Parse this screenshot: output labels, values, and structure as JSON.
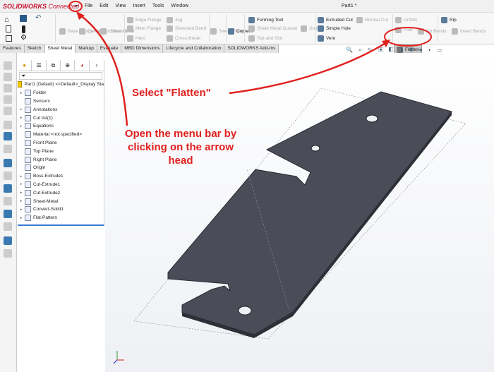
{
  "app": {
    "brand": "SOLIDWORKS",
    "brand_suffix": "Connected",
    "document_title": "Part1 *",
    "menu": [
      "File",
      "Edit",
      "View",
      "Insert",
      "Tools",
      "Window"
    ]
  },
  "ribbon": {
    "tools": [
      {
        "label": "Base Flange/Tab",
        "enabled": false
      },
      {
        "label": "Convert to Sheet Metal",
        "enabled": false
      },
      {
        "label": "Lofted-Bend",
        "enabled": false
      },
      {
        "label": "Edge Flange",
        "enabled": false
      },
      {
        "label": "Miter Flange",
        "enabled": false
      },
      {
        "label": "Hem",
        "enabled": false
      },
      {
        "label": "Jog",
        "enabled": false
      },
      {
        "label": "Sketched Bend",
        "enabled": false
      },
      {
        "label": "Cross-Break",
        "enabled": false
      },
      {
        "label": "Swept Flange",
        "enabled": false
      },
      {
        "label": "Corners",
        "enabled": true
      },
      {
        "label": "Forming Tool",
        "enabled": true
      },
      {
        "label": "Sheet Metal Gusset",
        "enabled": false
      },
      {
        "label": "Tab and Slot",
        "enabled": false
      },
      {
        "label": "Stamp",
        "enabled": false
      },
      {
        "label": "Extruded Cut",
        "enabled": true
      },
      {
        "label": "Simple Hole",
        "enabled": true
      },
      {
        "label": "Vent",
        "enabled": true
      },
      {
        "label": "Normal Cut",
        "enabled": false
      },
      {
        "label": "Unfold",
        "enabled": false
      },
      {
        "label": "Fold",
        "enabled": false
      },
      {
        "label": "No Bends",
        "enabled": false
      },
      {
        "label": "Rip",
        "enabled": true
      },
      {
        "label": "Insert Bends",
        "enabled": false
      }
    ],
    "flatten": "Flatten"
  },
  "tabs": [
    {
      "label": "Features"
    },
    {
      "label": "Sketch"
    },
    {
      "label": "Sheet Metal",
      "active": true
    },
    {
      "label": "Markup"
    },
    {
      "label": "Evaluate"
    },
    {
      "label": "MBD Dimensions"
    },
    {
      "label": "Lifecycle and Collaboration"
    },
    {
      "label": "SOLIDWORKS Add-Ins"
    }
  ],
  "tree": {
    "root": "Part1 (Default) <<Default>_Display Sta",
    "items": [
      {
        "label": "Folder",
        "expand": true
      },
      {
        "label": "Sensors",
        "expand": false
      },
      {
        "label": "Annotations",
        "expand": true
      },
      {
        "label": "Cut list(1)",
        "expand": true
      },
      {
        "label": "Equations",
        "expand": true
      },
      {
        "label": "Material <not specified>",
        "expand": false
      },
      {
        "label": "Front Plane",
        "expand": false
      },
      {
        "label": "Top Plane",
        "expand": false
      },
      {
        "label": "Right Plane",
        "expand": false
      },
      {
        "label": "Origin",
        "expand": false
      },
      {
        "label": "Boss-Extrude1",
        "expand": true
      },
      {
        "label": "Cut-Extrude1",
        "expand": true
      },
      {
        "label": "Cut-Extrude2",
        "expand": true
      },
      {
        "label": "Sheet-Metal",
        "expand": true
      },
      {
        "label": "Convert-Solid1",
        "expand": true
      },
      {
        "label": "Flat-Pattern",
        "expand": true
      }
    ]
  },
  "annotations": {
    "flatten_note": "Select \"Flatten\"",
    "menu_note": "Open the menu bar by clicking on the arrow head",
    "color": "#e0201e"
  },
  "colors": {
    "part": "#4a4c58",
    "accent": "#3b7bd6"
  }
}
